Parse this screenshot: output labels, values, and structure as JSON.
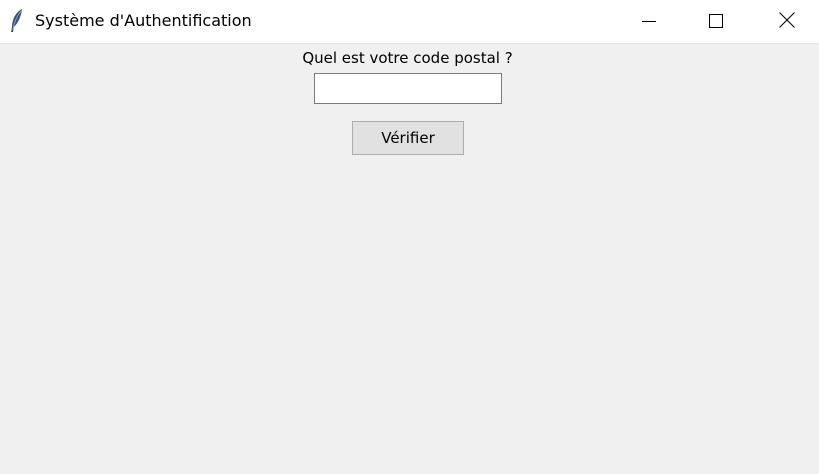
{
  "window": {
    "title": "Système d'Authentification",
    "app_icon": "feather-icon",
    "controls": {
      "minimize_icon": "minimize-icon",
      "maximize_icon": "maximize-icon",
      "close_icon": "close-icon"
    }
  },
  "form": {
    "prompt": "Quel est votre code postal ?",
    "postal_code": {
      "value": "",
      "placeholder": ""
    },
    "verify_label": "Vérifier"
  },
  "colors": {
    "window_background": "#f0f0f0",
    "titlebar_background": "#ffffff",
    "button_background": "#e1e1e1"
  }
}
